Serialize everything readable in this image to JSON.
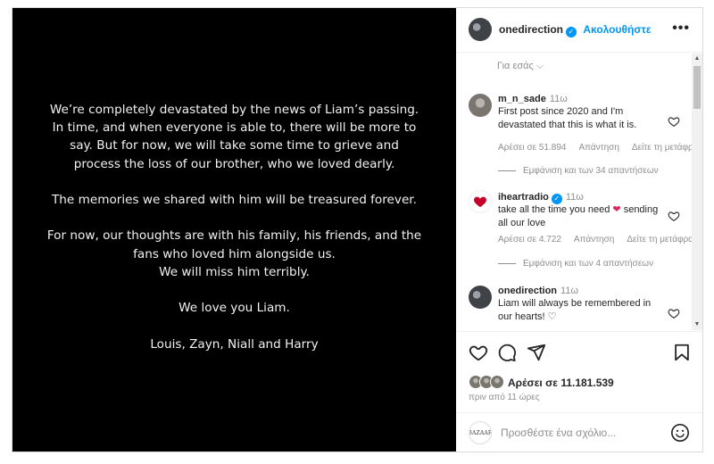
{
  "post_image": {
    "statement": [
      [
        "We’re completely devastated by the news of Liam’s passing.",
        "In time, and when everyone is able to, there will be more to",
        "say. But for now, we will take some time to grieve and",
        "process the loss of our brother, who we loved dearly."
      ],
      [
        "The memories we shared with him will be treasured forever."
      ],
      [
        "For now, our thoughts are with his family, his friends, and the",
        "fans who loved him alongside us.",
        "We will miss him terribly."
      ],
      [
        "We love you Liam."
      ],
      [
        "Louis, Zayn, Niall and Harry"
      ]
    ]
  },
  "header": {
    "username": "onedirection",
    "follow_label": "Ακολουθήστε",
    "more_icon": "more-horizontal-icon",
    "more_label": "•••"
  },
  "comments_section": {
    "for_you_label": "Για εσάς ⌵",
    "comments": [
      {
        "username": "m_n_sade",
        "time": "11ω",
        "text": "First post since 2020 and I'm devastated that this is what it is.",
        "likes": "Αρέσει σε 51.894",
        "reply_label": "Απάντηση",
        "translate_label": "Δείτε τη μετάφραση",
        "view_replies": "Εμφάνιση και των 34 απαντήσεων"
      },
      {
        "username": "iheartradio",
        "time": "11ω",
        "text": "take all the time you need ❤ sending all our love",
        "likes": "Αρέσει σε 4.722",
        "reply_label": "Απάντηση",
        "translate_label": "Δείτε τη μετάφραση",
        "view_replies": "Εμφάνιση και των 4 απαντήσεων"
      },
      {
        "username": "onedirection",
        "time": "11ω",
        "text": "Liam will always be remembered in our hearts! ♡"
      }
    ]
  },
  "actions": {
    "like_icon": "heart-icon",
    "comment_icon": "comment-icon",
    "share_icon": "share-icon",
    "save_icon": "bookmark-icon",
    "likes_text": "Αρέσει σε 11.181.539",
    "posted_time": "πριν από 11 ώρες"
  },
  "add_comment": {
    "avatar_text": "BAZAAR",
    "placeholder": "Προσθέστε ένα σχόλιο...",
    "emoji_icon": "emoji-icon"
  },
  "colors": {
    "accent": "#0095f6",
    "heart_red": "#e0245e",
    "image_bg": "#000000"
  }
}
